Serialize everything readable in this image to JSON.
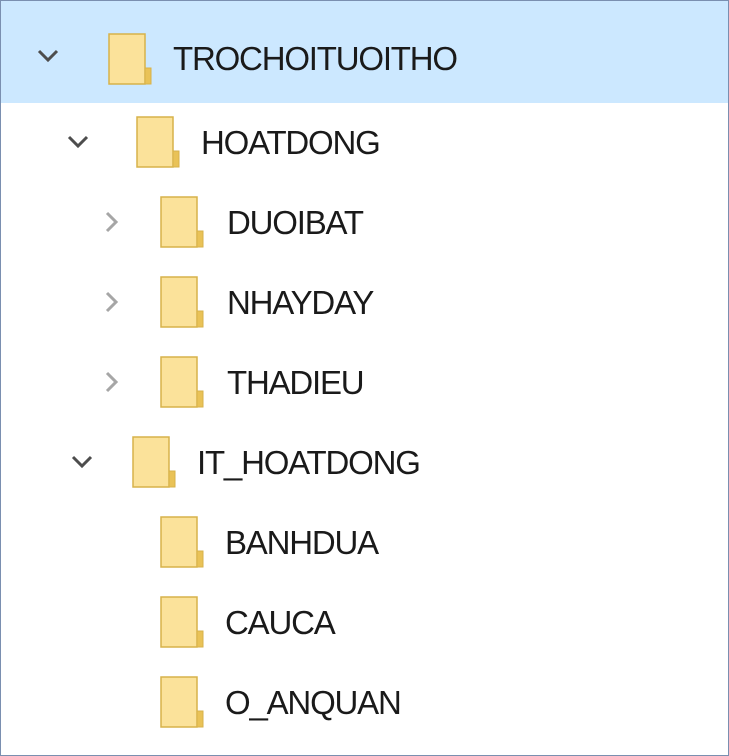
{
  "tree": {
    "items": [
      {
        "label": "TROCHOITUOITHO",
        "expander": "expanded",
        "icon": "folder-icon",
        "selected": true
      },
      {
        "label": "HOATDONG",
        "expander": "expanded",
        "icon": "folder-icon",
        "selected": false
      },
      {
        "label": "DUOIBAT",
        "expander": "collapsed",
        "icon": "folder-icon",
        "selected": false
      },
      {
        "label": "NHAYDAY",
        "expander": "collapsed",
        "icon": "folder-icon",
        "selected": false
      },
      {
        "label": "THADIEU",
        "expander": "collapsed",
        "icon": "folder-icon",
        "selected": false
      },
      {
        "label": "IT_HOATDONG",
        "expander": "expanded",
        "icon": "folder-icon",
        "selected": false
      },
      {
        "label": "BANHDUA",
        "expander": "none",
        "icon": "folder-icon",
        "selected": false
      },
      {
        "label": "CAUCA",
        "expander": "none",
        "icon": "folder-icon",
        "selected": false
      },
      {
        "label": "O_ANQUAN",
        "expander": "none",
        "icon": "folder-icon",
        "selected": false
      }
    ]
  },
  "colors": {
    "selection": "#cce8ff",
    "folder_fill": "#fbe29a",
    "folder_edge": "#d7b24a",
    "chevron_dark": "#4d4d4d",
    "chevron_light": "#a6a6a6"
  }
}
